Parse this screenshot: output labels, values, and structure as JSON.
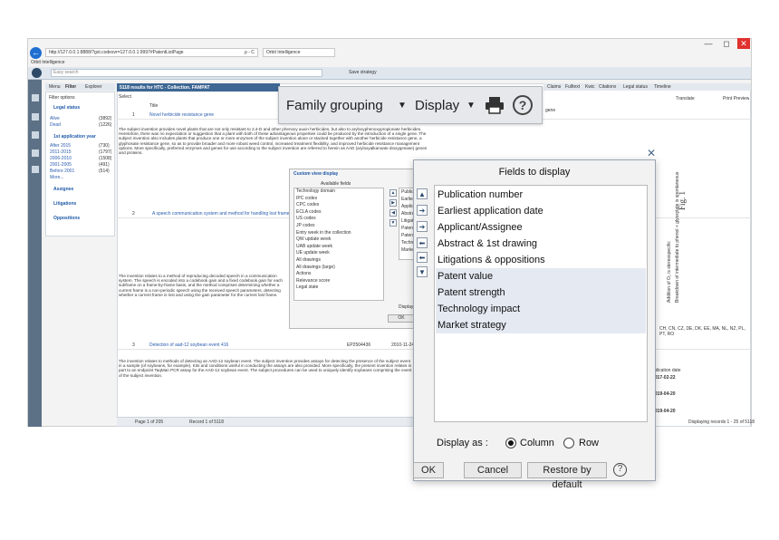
{
  "browser": {
    "back": "←",
    "url": "http://127.0.0.1:8888/?gxt.codesvr=127.0.0.1:9997#PatentListPage",
    "tab_title": "Orbit Intelligence",
    "app_label": "Orbit Intelligence",
    "search_hint": "ρ - C",
    "minimize": "—",
    "maximize": "◻",
    "close": "✕"
  },
  "app": {
    "easy_search": "Easy search",
    "save_strategy": "Save strategy",
    "tabs": [
      "Menu",
      "Filter",
      "Explorer"
    ],
    "filter_options": "Filter options",
    "legal_status": "Legal status",
    "legal_items": [
      {
        "label": "Alive",
        "count": "(3892)"
      },
      {
        "label": "Dead",
        "count": "(1226)"
      }
    ],
    "app_year": "1st application year",
    "year_items": [
      {
        "label": "After 2015",
        "count": "(730)"
      },
      {
        "label": "2011-2015",
        "count": "(1797)"
      },
      {
        "label": "2006-2010",
        "count": "(1508)"
      },
      {
        "label": "2001-2005",
        "count": "(491)"
      },
      {
        "label": "Before 2001",
        "count": "(514)"
      }
    ],
    "more": "More...",
    "assignee": "Assignee",
    "litigations": "Litigations",
    "oppositions": "Oppositions",
    "results_title": "5118 results for HTC - Collection. FAMPAT",
    "select": "Select",
    "title_col": "Title",
    "results": [
      {
        "num": "1",
        "title": "Novel herbicide resistance gene"
      },
      {
        "num": "2",
        "title": "A speech communication system and method for handling lost frames"
      },
      {
        "num": "3",
        "title": "Detection of aad-12 soybean event 416",
        "pub": "EP2504436",
        "date": "2010-11-24"
      }
    ],
    "abstract_1": "The subject invention provides novel plants that are not only resistant to 2,4-D and other phenoxy auxin herbicides, but also to aryloxyphenoxypropionate herbicides. Heretofore, there was no expectation or suggestion that a plant with both of these advantageous properties could be produced by the introduction of a single gene. The subject invention also includes plants that produce one or more enzymes of the subject invention alone or stacked together with another herbicide resistance gene, a glyphosate resistance gene, so as to provide broader and more robust weed control, increased treatment flexibility, and improved herbicide resistance management options. More specifically, preferred enzymes and genes for use according to the subject invention are referred to herein as AAD (aryloxyalkanoate dioxygenase) genes and proteins.",
    "abstract_2": "The invention relates to a method of reproducing decoded speech in a communication system. The speech is encoded into a codebook gain and a fixed codebook gain for each subframe on a frame-by-frame basis, and the method comprises determining whether a current frame is a non-periodic speech using the received speech parameters, detecting whether a current frame is lost and using the gain parameter for the current lost frame.",
    "abstract_3": "The invention relates to methods of detecting an AAD-12 soybean event. The subject invention provides assays for detecting the presence of the subject event in a sample (of soybeans, for example). Kits and conditions useful in conducting the assays are also provided. More specifically, the present invention relates in part to an endpoint TaqMan PCR assay for the AAD-12 soybean event. The subject procedures can be used to uniquely identify soybeans comprising the event of the subject invention.",
    "pager": "Page 1 of 205",
    "record": "Record 1 of 5118",
    "right_tabs": [
      "Claims",
      "Fulltext",
      "Kwic",
      "Citations",
      "Legal status",
      "Timeline"
    ],
    "translate": "Translate",
    "print_preview": "Print Preview",
    "gene_label": "gene",
    "vertical_text": "Addition of O₂ is stereospecific",
    "vertical_text2": "Breakdown of intermediate to phenol + glyoxylate is spontaneous",
    "fig": "Fig. 1",
    "countries": "CH, CN, CZ, DE, DK, EE, MA, NL, NZ, PL, PT, RO",
    "pub_date_header": "Publication date",
    "dates": [
      "2017-02-22",
      "2019-04-20",
      "2019-04-20"
    ],
    "displaying": "Displaying records 1 - 25 of 5118"
  },
  "zoom_toolbar": {
    "family_grouping": "Family grouping",
    "display": "Display",
    "print_icon": "printer-icon",
    "help_icon": "help-icon"
  },
  "small_dialog": {
    "title": "Custom view display",
    "available_fields": "Available fields",
    "fields": [
      "Technology domain",
      "IPC codes",
      "CPC codes",
      "ECLA codes",
      "US codes",
      "JP codes",
      "Entry week in the collection",
      "QW update week",
      "UAB update week",
      "UE update week",
      "All drawings",
      "All drawings (large)",
      "Actions",
      "Relevance score",
      "Legal state"
    ],
    "selected_short": [
      "Publicat",
      "Earliest",
      "Applican",
      "Abstract",
      "Litigatio",
      "Patent v",
      "Patent s",
      "Technol",
      "Market s"
    ],
    "display_label": "Display",
    "ok": "OK"
  },
  "dialog": {
    "title": "Fields to display",
    "close": "✕",
    "fields": [
      "Publication number",
      "Earliest application date",
      "Applicant/Assignee",
      "Abstract & 1st drawing",
      "Litigations & oppositions",
      "Patent value",
      "Patent strength",
      "Technology impact",
      "Market strategy"
    ],
    "display_as": "Display as :",
    "column": "Column",
    "row": "Row",
    "ok": "OK",
    "cancel": "Cancel",
    "restore": "Restore by default",
    "help": "?"
  }
}
